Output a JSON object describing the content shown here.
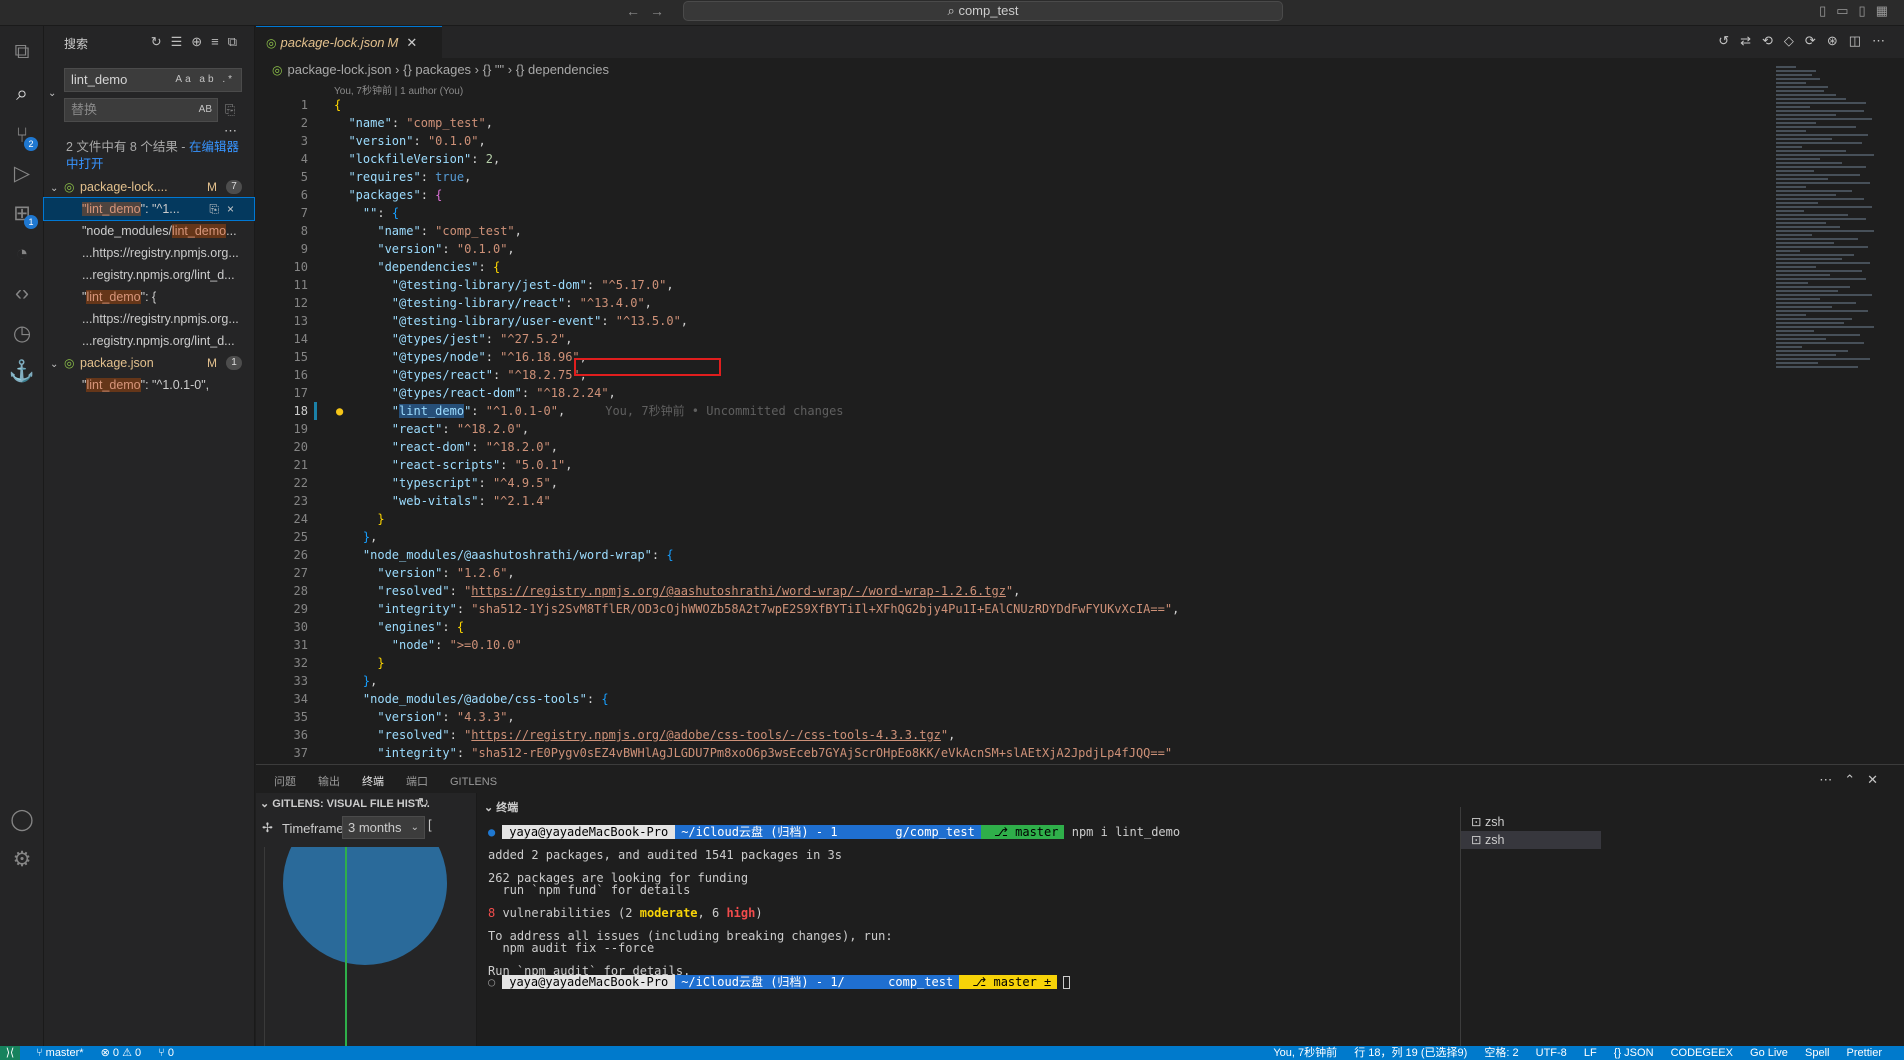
{
  "titlebar": {
    "search_label": "comp_test"
  },
  "activitybar": {
    "scm_badge": "2",
    "extensions_badge": "1"
  },
  "sidebar": {
    "title": "搜索",
    "search_value": "lint_demo",
    "search_flags": "Aa ab .*",
    "replace_placeholder": "替换",
    "replace_flag": "AB",
    "summary": "2 文件中有 8 个结果 - ",
    "summary_link": "在编辑器中打开",
    "files": [
      {
        "name": "package-lock....",
        "status": "M",
        "count": "7"
      },
      {
        "name": "package.json",
        "status": "M",
        "count": "1"
      }
    ],
    "matches_lock": [
      {
        "pre": "",
        "hit": "\"lint_demo",
        "post": "\": \"^1..."
      },
      {
        "pre": "\"node_modules/",
        "hit": "lint_demo",
        "post": "..."
      },
      {
        "pre": "...https://registry.npmjs.org",
        "hit": "",
        "post": "..."
      },
      {
        "pre": "...registry.npmjs.org/lint_d...",
        "hit": "",
        "post": ""
      },
      {
        "pre": "\"",
        "hit": "lint_demo",
        "post": "\": {"
      },
      {
        "pre": "...https://registry.npmjs.org",
        "hit": "",
        "post": "..."
      },
      {
        "pre": "...registry.npmjs.org/lint_d...",
        "hit": "",
        "post": ""
      }
    ],
    "matches_pkg": [
      {
        "pre": "\"",
        "hit": "lint_demo",
        "post": "\": \"^1.0.1-0\","
      }
    ]
  },
  "editor": {
    "tab_name": "package-lock.json",
    "tab_status": "M",
    "breadcrumb": [
      "package-lock.json",
      "{} packages",
      "{} \"\"",
      "{} dependencies"
    ],
    "blame_header": "You, 7秒钟前 | 1 author (You)",
    "inline_blame": "You, 7秒钟前 • Uncommitted changes",
    "current_line": "18"
  },
  "panel": {
    "tabs": [
      "问题",
      "输出",
      "终端",
      "端口",
      "GITLENS"
    ],
    "active_tab": "终端",
    "gitlens_title": "GITLENS: VISUAL FILE HIST...",
    "timeframe_label": "Timeframe",
    "timeframe_value": "3 months",
    "terminal_title": "终端",
    "terminal_sessions": [
      "zsh",
      "zsh"
    ],
    "prompt_user": "yaya@yayadeMacBook-Pro",
    "prompt_path_1": "~/iCloud云盘 (归档) - 1",
    "prompt_path_1b": "g/comp_test",
    "prompt_path_2": "~/iCloud云盘 (归档) - 1/",
    "prompt_path_2b": "comp_test",
    "prompt_branch_1": "master",
    "prompt_branch_2": "master ±",
    "command": "npm i lint_demo",
    "output": [
      "added 2 packages, and audited 1541 packages in 3s",
      "",
      "262 packages are looking for funding",
      "  run `npm fund` for details",
      "",
      "VULN",
      "",
      "To address all issues (including breaking changes), run:",
      "  npm audit fix --force",
      "",
      "Run `npm audit` for details."
    ],
    "vuln": {
      "count": "8",
      "pre": " vulnerabilities (2 ",
      "moderate": "moderate",
      "mid": ", 6 ",
      "high": "high",
      "post": ")"
    }
  },
  "statusbar": {
    "left": [
      "master*",
      "⊗ 0 ⚠ 0",
      "⑂ 0"
    ],
    "right": [
      "You, 7秒钟前",
      "行 18，列 19 (已选择9)",
      "空格: 2",
      "UTF-8",
      "LF",
      "{} JSON",
      "CODEGEEX",
      "Go Live",
      "Spell",
      "Prettier"
    ]
  },
  "colors": {
    "accent": "#007acc",
    "modified": "#e2c08d",
    "match_highlight": "#ea5c00"
  }
}
